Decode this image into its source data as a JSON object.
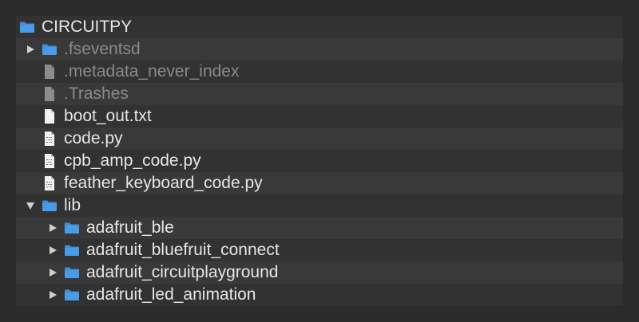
{
  "tree": {
    "root": {
      "label": "CIRCUITPY",
      "icon": "folder-icon"
    },
    "items": [
      {
        "label": ".fseventsd",
        "icon": "folder-icon",
        "toggle": "collapsed",
        "depth": 1,
        "dim": true
      },
      {
        "label": ".metadata_never_index",
        "icon": "file-icon",
        "toggle": "none",
        "depth": 1,
        "dim": true
      },
      {
        "label": ".Trashes",
        "icon": "file-icon",
        "toggle": "none",
        "depth": 1,
        "dim": true
      },
      {
        "label": "boot_out.txt",
        "icon": "text-file-icon",
        "toggle": "none",
        "depth": 1,
        "dim": false
      },
      {
        "label": "code.py",
        "icon": "python-file-icon",
        "toggle": "none",
        "depth": 1,
        "dim": false
      },
      {
        "label": "cpb_amp_code.py",
        "icon": "python-file-icon",
        "toggle": "none",
        "depth": 1,
        "dim": false
      },
      {
        "label": "feather_keyboard_code.py",
        "icon": "python-file-icon",
        "toggle": "none",
        "depth": 1,
        "dim": false
      },
      {
        "label": "lib",
        "icon": "folder-icon",
        "toggle": "expanded",
        "depth": 1,
        "dim": false
      },
      {
        "label": "adafruit_ble",
        "icon": "folder-icon",
        "toggle": "collapsed",
        "depth": 2,
        "dim": false
      },
      {
        "label": "adafruit_bluefruit_connect",
        "icon": "folder-icon",
        "toggle": "collapsed",
        "depth": 2,
        "dim": false
      },
      {
        "label": "adafruit_circuitplayground",
        "icon": "folder-icon",
        "toggle": "collapsed",
        "depth": 2,
        "dim": false
      },
      {
        "label": "adafruit_led_animation",
        "icon": "folder-icon",
        "toggle": "collapsed",
        "depth": 2,
        "dim": false
      }
    ]
  },
  "colors": {
    "background": "#2b2b2b",
    "panel": "#323232",
    "stripe": "#393939",
    "text": "#e6e6e6",
    "dim_text": "#8a8a8a",
    "folder_blue": "#3f8fd8"
  }
}
